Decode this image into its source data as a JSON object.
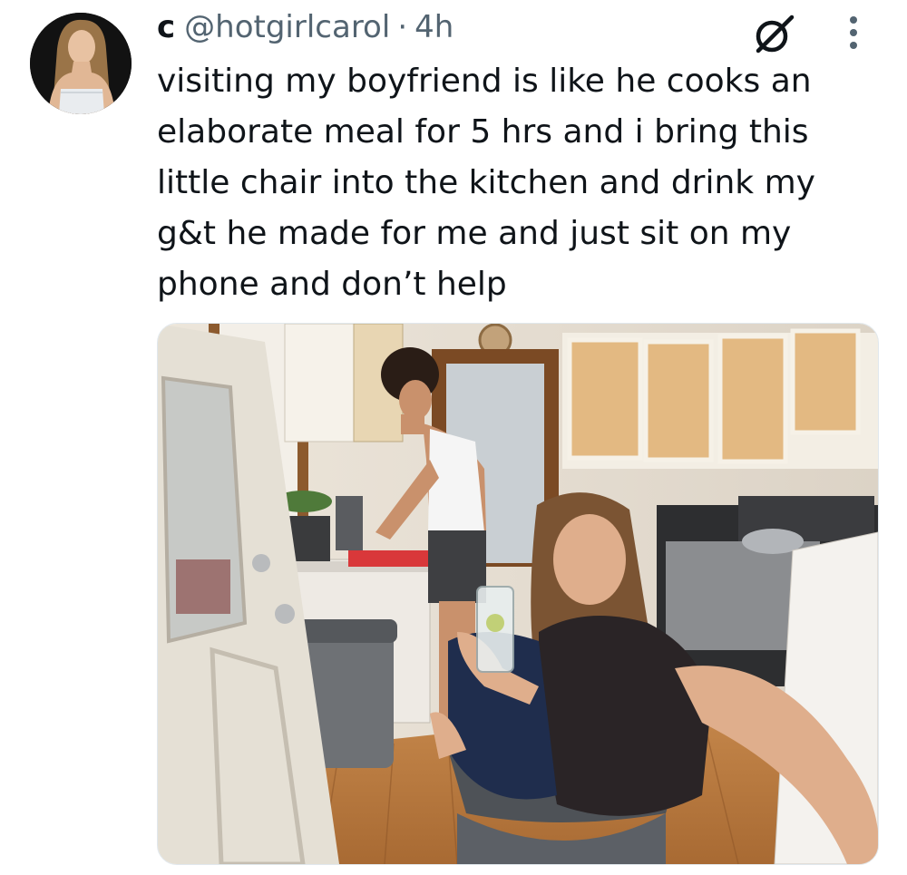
{
  "tweet": {
    "display_name": "c",
    "handle": "@hotgirlcarol",
    "separator": "·",
    "timestamp": "4h",
    "text": "visiting my boyfriend is like he cooks an\nelaborate meal for 5 hrs and i bring this\nlittle chair into the kitchen and drink my\ng&t he made for me and just sit on my\nphone and don’t help"
  },
  "icons": {
    "grok": "grok-slash-circle-icon",
    "more": "more-vertical-dots-icon",
    "avatar": "user-avatar-photo"
  },
  "colors": {
    "text_primary": "#0f1419",
    "text_secondary": "#536471",
    "background": "#ffffff"
  }
}
